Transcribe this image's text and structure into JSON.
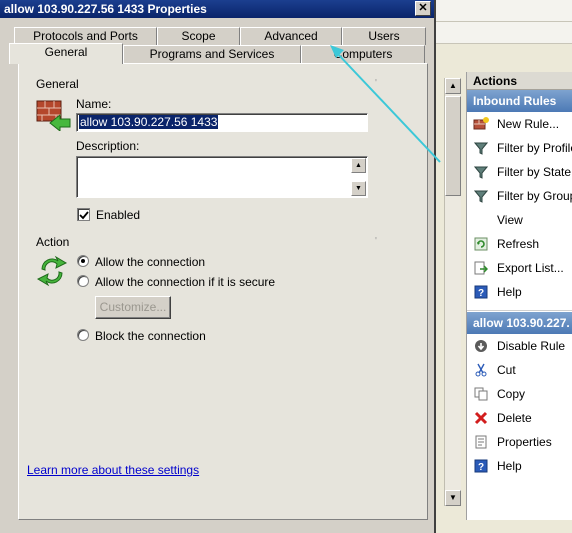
{
  "dialog": {
    "title": "allow 103.90.227.56 1433 Properties",
    "close_glyph": "✕",
    "tabs_back": [
      "Protocols and Ports",
      "Scope",
      "Advanced",
      "Users"
    ],
    "tabs_front": [
      "General",
      "Programs and Services",
      "Computers"
    ],
    "active_tab": "General",
    "general": {
      "group_label": "General",
      "name_label": "Name:",
      "name_value": "allow 103.90.227.56 1433",
      "description_label": "Description:",
      "description_value": "",
      "enabled_label": "Enabled",
      "enabled_checked": true
    },
    "action": {
      "group_label": "Action",
      "options": [
        "Allow the connection",
        "Allow the connection if it is secure",
        "Block the connection"
      ],
      "selected": "Allow the connection",
      "customize_label": "Customize..."
    },
    "learn_more": "Learn more about these settings"
  },
  "actions_pane": {
    "header": "Actions",
    "inbound_section": "Inbound Rules",
    "inbound_items": [
      {
        "label": "New Rule...",
        "icon": "new-rule-icon"
      },
      {
        "label": "Filter by Profile",
        "icon": "filter-icon"
      },
      {
        "label": "Filter by State",
        "icon": "filter-icon"
      },
      {
        "label": "Filter by Group",
        "icon": "filter-icon"
      },
      {
        "label": "View",
        "icon": ""
      },
      {
        "label": "Refresh",
        "icon": "refresh-icon"
      },
      {
        "label": "Export List...",
        "icon": "export-icon"
      },
      {
        "label": "Help",
        "icon": "help-icon"
      }
    ],
    "rule_section": "allow 103.90.227.",
    "rule_items": [
      {
        "label": "Disable Rule",
        "icon": "disable-icon"
      },
      {
        "label": "Cut",
        "icon": "cut-icon"
      },
      {
        "label": "Copy",
        "icon": "copy-icon"
      },
      {
        "label": "Delete",
        "icon": "delete-icon"
      },
      {
        "label": "Properties",
        "icon": "properties-icon"
      },
      {
        "label": "Help",
        "icon": "help-icon"
      }
    ]
  },
  "colors": {
    "title_bar": "#0a246a",
    "section_header": "#4c79b5",
    "annotation_arrow": "#3cc8d8",
    "link": "#0000cc"
  }
}
